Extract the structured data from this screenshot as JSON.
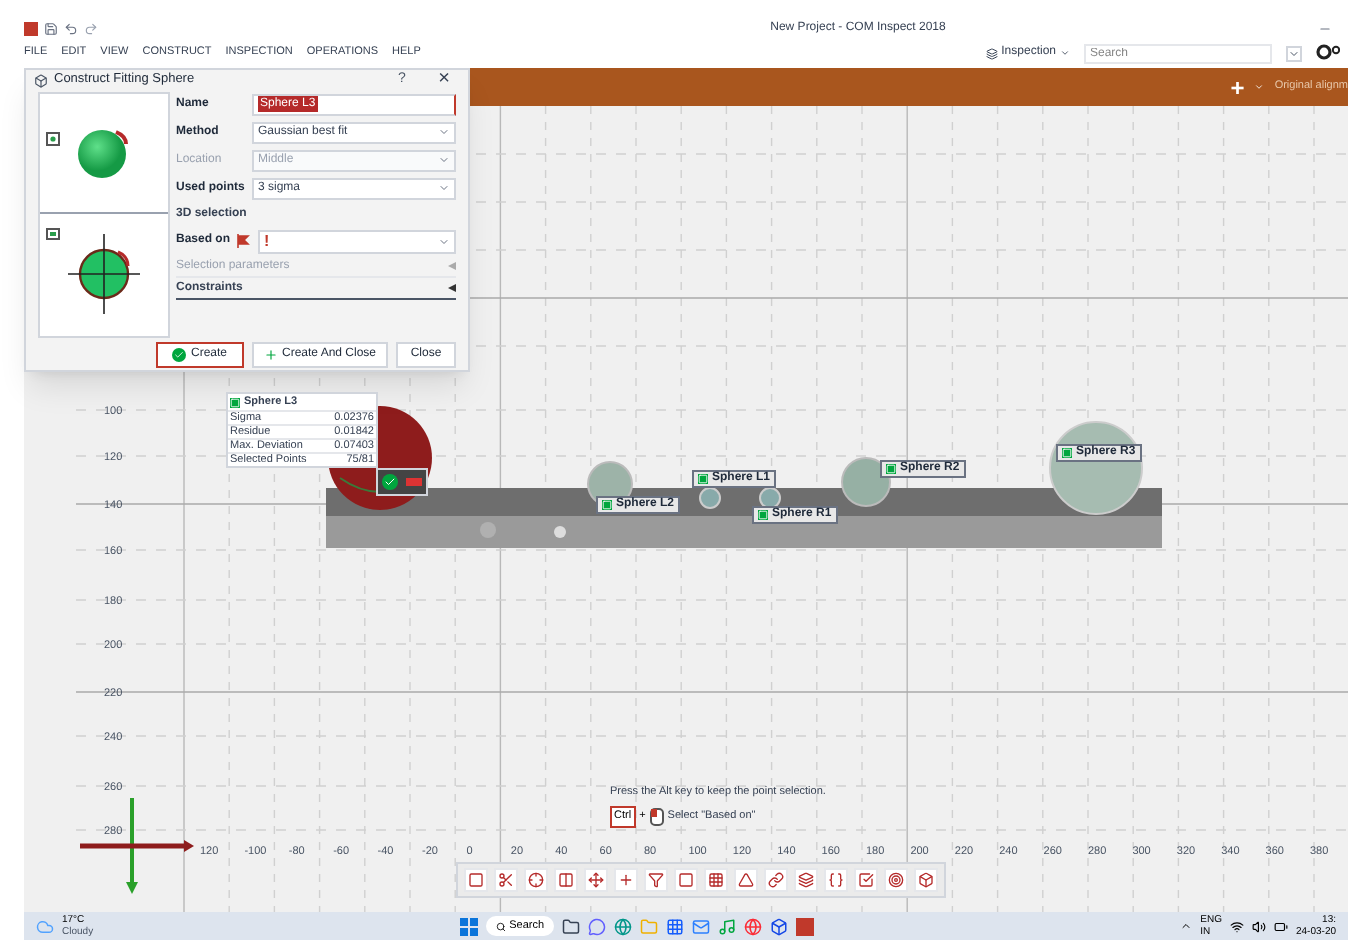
{
  "window": {
    "title": "New Project - COM Inspect 2018"
  },
  "menu": [
    "FILE",
    "EDIT",
    "VIEW",
    "CONSTRUCT",
    "INSPECTION",
    "OPERATIONS",
    "HELP"
  ],
  "workspace": {
    "label": "Inspection"
  },
  "search": {
    "placeholder": "Search"
  },
  "ribbon": {
    "add": "+",
    "alignment": "Original alignm"
  },
  "dialog": {
    "title": "Construct Fitting Sphere",
    "help": "?",
    "close": "×",
    "fields": [
      {
        "kind": "text",
        "label": "Name",
        "value": "Sphere L3",
        "disabled": false
      },
      {
        "kind": "select",
        "label": "Method",
        "value": "Gaussian best fit",
        "disabled": false
      },
      {
        "kind": "select",
        "label": "Location",
        "value": "Middle",
        "disabled": true
      },
      {
        "kind": "select",
        "label": "Used points",
        "value": "3 sigma",
        "disabled": false
      },
      {
        "kind": "heading",
        "label": "3D selection"
      },
      {
        "kind": "based_on",
        "label": "Based on",
        "value": "!"
      },
      {
        "kind": "section",
        "label": "Selection parameters",
        "disabled": true
      },
      {
        "kind": "section",
        "label": "Constraints",
        "disabled": false
      }
    ],
    "buttons": [
      {
        "kind": "create",
        "label": "Create"
      },
      {
        "kind": "create_close",
        "label": "Create And Close"
      },
      {
        "kind": "close",
        "label": "Close"
      }
    ]
  },
  "results": {
    "title": "Sphere L3",
    "rows": [
      {
        "name": "Sigma",
        "value": "0.02376"
      },
      {
        "name": "Residue",
        "value": "0.01842"
      },
      {
        "name": "Max. Deviation",
        "value": "0.07403"
      },
      {
        "name": "Selected Points",
        "value": "75/81"
      }
    ]
  },
  "features": [
    {
      "label": "Sphere L2"
    },
    {
      "label": "Sphere L1"
    },
    {
      "label": "Sphere R1"
    },
    {
      "label": "Sphere R2"
    },
    {
      "label": "Sphere R3"
    }
  ],
  "y_axis": [
    "100",
    "120",
    "140",
    "160",
    "180",
    "200",
    "220",
    "240",
    "260",
    "280"
  ],
  "x_axis": [
    "120",
    "-100",
    "-80",
    "-60",
    "-40",
    "-20",
    "0",
    "20",
    "40",
    "60",
    "80",
    "100",
    "120",
    "140",
    "160",
    "180",
    "200",
    "220",
    "240",
    "260",
    "280",
    "300",
    "320",
    "340",
    "360",
    "380"
  ],
  "hint": {
    "text": "Press the Alt key to keep the point selection.",
    "key": "Ctrl",
    "plus": "+",
    "action": "Select \"Based on\""
  },
  "taskbar": {
    "temperature": "17°C",
    "weather": "Cloudy",
    "search": "Search",
    "language": "ENG",
    "region": "IN",
    "time": "13:",
    "date": "24-03-20"
  }
}
